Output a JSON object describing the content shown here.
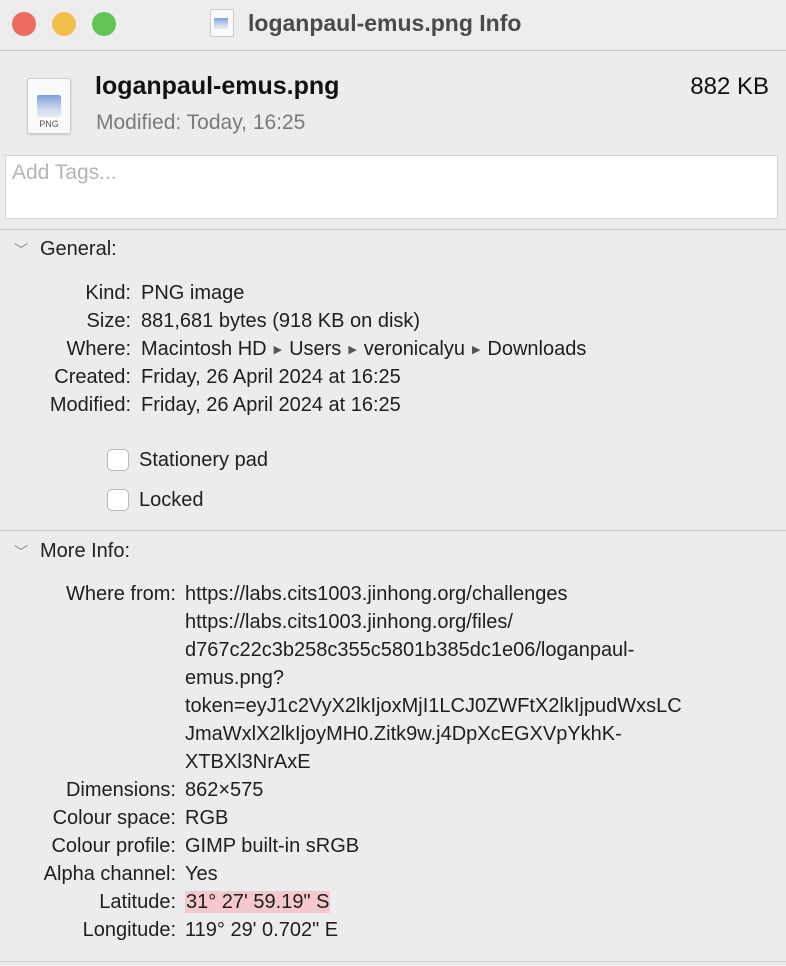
{
  "window": {
    "title": "loganpaul-emus.png Info",
    "traffic_lights": {
      "close": "#ed6a5e",
      "minimize": "#f5bf4f",
      "zoom": "#61c554"
    }
  },
  "header": {
    "file_name": "loganpaul-emus.png",
    "file_size": "882 KB",
    "modified": "Modified: Today, 16:25",
    "icon_label": "PNG"
  },
  "tags": {
    "placeholder": "Add Tags..."
  },
  "general": {
    "title": "General:",
    "kind": {
      "label": "Kind:",
      "value": "PNG image"
    },
    "size": {
      "label": "Size:",
      "value": "881,681 bytes (918 KB on disk)"
    },
    "where": {
      "label": "Where:",
      "parts": [
        "Macintosh HD",
        "Users",
        "veronicalyu",
        "Downloads"
      ]
    },
    "created": {
      "label": "Created:",
      "value": "Friday, 26 April 2024 at 16:25"
    },
    "modified": {
      "label": "Modified:",
      "value": "Friday, 26 April 2024 at 16:25"
    },
    "stationery": {
      "label": "Stationery pad",
      "checked": false
    },
    "locked": {
      "label": "Locked",
      "checked": false
    }
  },
  "more_info": {
    "title": "More Info:",
    "where_from": {
      "label": "Where from:",
      "lines": [
        "https://labs.cits1003.jinhong.org/challenges",
        "https://labs.cits1003.jinhong.org/files/",
        "d767c22c3b258c355c5801b385dc1e06/loganpaul-",
        "emus.png?",
        "token=eyJ1c2VyX2lkIjoxMjI1LCJ0ZWFtX2lkIjpudWxsLC",
        "JmaWxlX2lkIjoyMH0.Zitk9w.j4DpXcEGXVpYkhK-",
        "XTBXl3NrAxE"
      ]
    },
    "dimensions": {
      "label": "Dimensions:",
      "value": "862×575"
    },
    "colour_space": {
      "label": "Colour space:",
      "value": "RGB"
    },
    "colour_profile": {
      "label": "Colour profile:",
      "value": "GIMP built-in sRGB"
    },
    "alpha": {
      "label": "Alpha channel:",
      "value": "Yes"
    },
    "latitude": {
      "label": "Latitude:",
      "value": "31° 27' 59.19\" S",
      "highlight": "#f4c8cc"
    },
    "longitude": {
      "label": "Longitude:",
      "value": "119° 29' 0.702\" E"
    }
  }
}
